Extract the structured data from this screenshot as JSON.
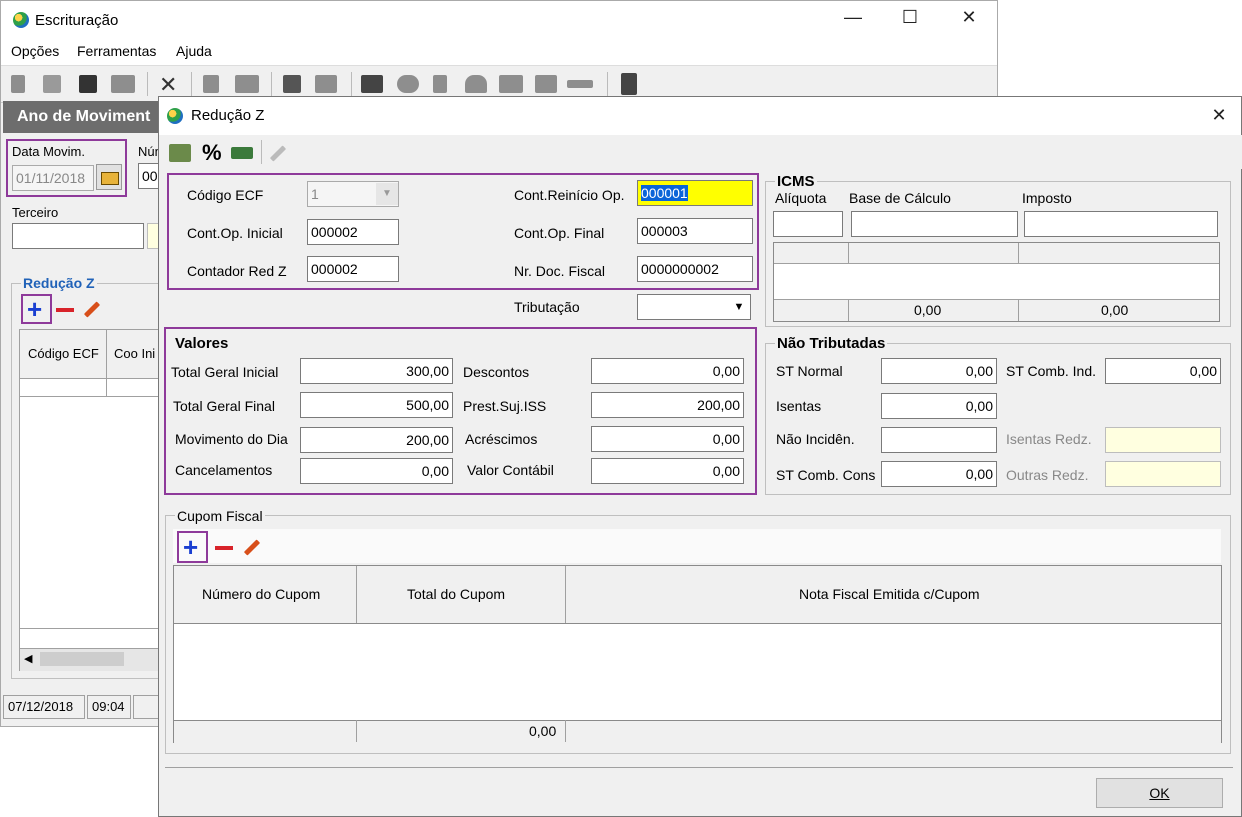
{
  "back_window": {
    "title": "Escrituração",
    "menu": [
      "Opções",
      "Ferramentas",
      "Ajuda"
    ],
    "panel_title": "Ano de Moviment",
    "data_movim_label": "Data Movim.",
    "data_movim_value": "01/11/2018",
    "num_label": "Núm",
    "num_value": "00",
    "terceiro_label": "Terceiro",
    "reducao_label": "Redução Z",
    "grid_headers": [
      "Código ECF",
      "Coo Ini"
    ],
    "status": [
      "07/12/2018",
      "09:04"
    ]
  },
  "dialog": {
    "title": "Redução Z",
    "close_glyph": "✕",
    "toolbar_percent": "%",
    "top": {
      "codigo_ecf_label": "Código ECF",
      "codigo_ecf_value": "1",
      "cont_op_inicial_label": "Cont.Op. Inicial",
      "cont_op_inicial_value": "000002",
      "contador_red_z_label": "Contador Red Z",
      "contador_red_z_value": "000002",
      "cont_reinicio_label": "Cont.Reinício Op.",
      "cont_reinicio_value": "000001",
      "cont_op_final_label": "Cont.Op. Final",
      "cont_op_final_value": "000003",
      "nr_doc_fiscal_label": "Nr. Doc. Fiscal",
      "nr_doc_fiscal_value": "0000000002",
      "tributacao_label": "Tributação",
      "tributacao_value": ""
    },
    "icms": {
      "title": "ICMS",
      "headers": [
        "Alíquota",
        "Base de Cálculo",
        "Imposto"
      ],
      "totals": [
        "0,00",
        "0,00"
      ]
    },
    "valores": {
      "title": "Valores",
      "total_geral_inicial_label": "Total Geral Inicial",
      "total_geral_inicial_value": "300,00",
      "total_geral_final_label": "Total Geral Final",
      "total_geral_final_value": "500,00",
      "movimento_do_dia_label": "Movimento do Dia",
      "movimento_do_dia_value": "200,00",
      "cancelamentos_label": "Cancelamentos",
      "cancelamentos_value": "0,00",
      "descontos_label": "Descontos",
      "descontos_value": "0,00",
      "prest_suj_iss_label": "Prest.Suj.ISS",
      "prest_suj_iss_value": "200,00",
      "acrescimos_label": "Acréscimos",
      "acrescimos_value": "0,00",
      "valor_contabil_label": "Valor Contábil",
      "valor_contabil_value": "0,00"
    },
    "nao_tributadas": {
      "title": "Não Tributadas",
      "st_normal_label": "ST Normal",
      "st_normal_value": "0,00",
      "st_comb_ind_label": "ST Comb. Ind.",
      "st_comb_ind_value": "0,00",
      "isentas_label": "Isentas",
      "isentas_value": "0,00",
      "nao_inciden_label": "Não Incidên.",
      "nao_inciden_value": "",
      "isentas_redz_label": "Isentas Redz.",
      "st_comb_cons_label": "ST Comb. Cons",
      "st_comb_cons_value": "0,00",
      "outras_redz_label": "Outras Redz."
    },
    "cupom": {
      "title": "Cupom Fiscal",
      "headers": [
        "Número do Cupom",
        "Total do Cupom",
        "Nota Fiscal Emitida c/Cupom"
      ],
      "total": "0,00"
    },
    "ok_label": "OK"
  },
  "colors": {
    "highlight_border": "#8e3a9a",
    "selected_field": "#ffff00",
    "panel_header": "#6d6d6d"
  }
}
